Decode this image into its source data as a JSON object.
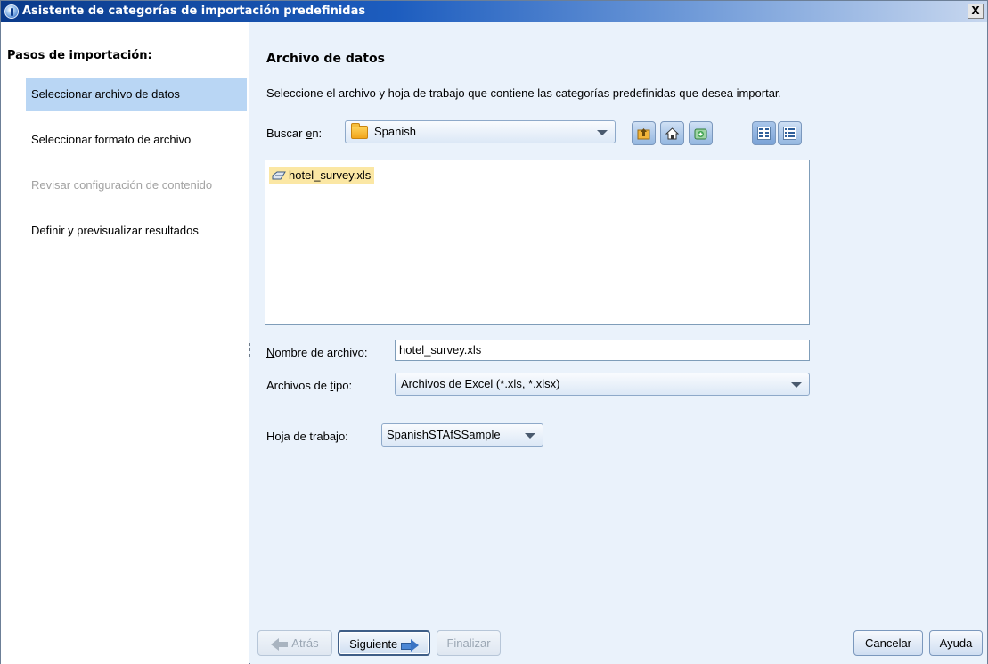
{
  "window": {
    "title": "Asistente de categorías de importación predefinidas",
    "close_glyph": "X"
  },
  "sidebar": {
    "heading": "Pasos de importación:",
    "steps": [
      {
        "label": "Seleccionar archivo de datos",
        "state": "active"
      },
      {
        "label": "Seleccionar formato de archivo",
        "state": "enabled"
      },
      {
        "label": "Revisar configuración de contenido",
        "state": "disabled"
      },
      {
        "label": "Definir y previsualizar resultados",
        "state": "enabled"
      }
    ]
  },
  "main": {
    "section_title": "Archivo de datos",
    "instruction": "Seleccione el archivo y hoja de trabajo que contiene las categorías predefinidas que desea importar.",
    "look_in": {
      "label_prefix": "Buscar ",
      "label_mnemonic": "e",
      "label_suffix": "n:",
      "value": "Spanish",
      "icon": "folder-icon"
    },
    "toolbar": [
      {
        "name": "up-folder-icon"
      },
      {
        "name": "home-icon"
      },
      {
        "name": "new-folder-icon"
      },
      {
        "name": "list-view-icon"
      },
      {
        "name": "details-view-icon"
      }
    ],
    "files": [
      {
        "name": "hotel_survey.xls",
        "icon": "excel-file-icon",
        "selected": true
      }
    ],
    "file_name": {
      "label_mnemonic": "N",
      "label_suffix": "ombre de archivo:",
      "value": "hotel_survey.xls"
    },
    "file_type": {
      "label_prefix": "Archivos de ",
      "label_mnemonic": "t",
      "label_suffix": "ipo:",
      "value": "Archivos de Excel (*.xls, *.xlsx)"
    },
    "worksheet": {
      "label": "Hoja de trabajo:",
      "value": "SpanishSTAfSSample"
    }
  },
  "buttons": {
    "back": "Atrás",
    "next": "Siguiente",
    "finish": "Finalizar",
    "cancel": "Cancelar",
    "help": "Ayuda"
  },
  "colors": {
    "title_bar": "#0a3a8a",
    "panel_bg": "#eaf2fb",
    "active_step": "#b9d6f4",
    "selected_file": "#fbe7a4"
  }
}
